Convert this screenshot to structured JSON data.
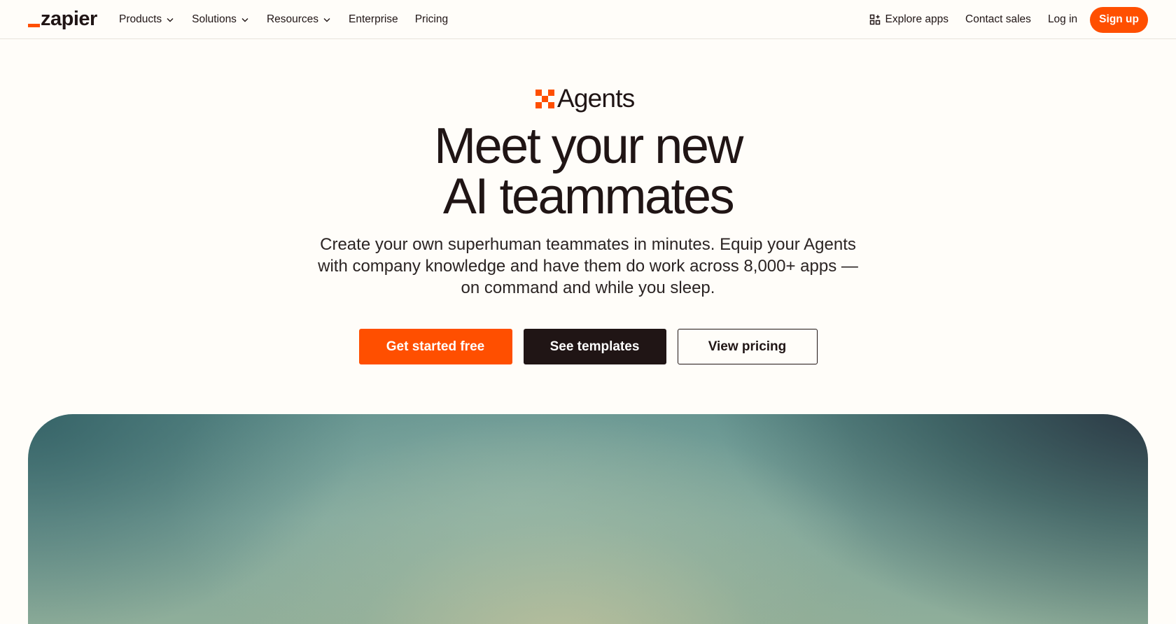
{
  "nav": {
    "logo_text": "zapier",
    "logo_accent_color": "#ff4f00",
    "items": [
      {
        "label": "Products",
        "has_dropdown": true
      },
      {
        "label": "Solutions",
        "has_dropdown": true
      },
      {
        "label": "Resources",
        "has_dropdown": true
      },
      {
        "label": "Enterprise",
        "has_dropdown": false
      },
      {
        "label": "Pricing",
        "has_dropdown": false
      }
    ],
    "right": {
      "explore_apps": "Explore apps",
      "contact_sales": "Contact sales",
      "log_in": "Log in",
      "sign_up": "Sign up"
    }
  },
  "hero": {
    "product_name": "Agents",
    "product_icon": "agents-pixel-x-icon",
    "headline_line1": "Meet your new",
    "headline_line2": "AI teammates",
    "subheadline": "Create your own superhuman teammates in minutes. Equip your Agents with company knowledge and have them do work across 8,000+ apps — on command and while you sleep.",
    "cta_primary": "Get started free",
    "cta_secondary": "See templates",
    "cta_tertiary": "View pricing"
  },
  "colors": {
    "brand_orange": "#ff4f00",
    "text_dark": "#201515",
    "background": "#fffdf9"
  }
}
